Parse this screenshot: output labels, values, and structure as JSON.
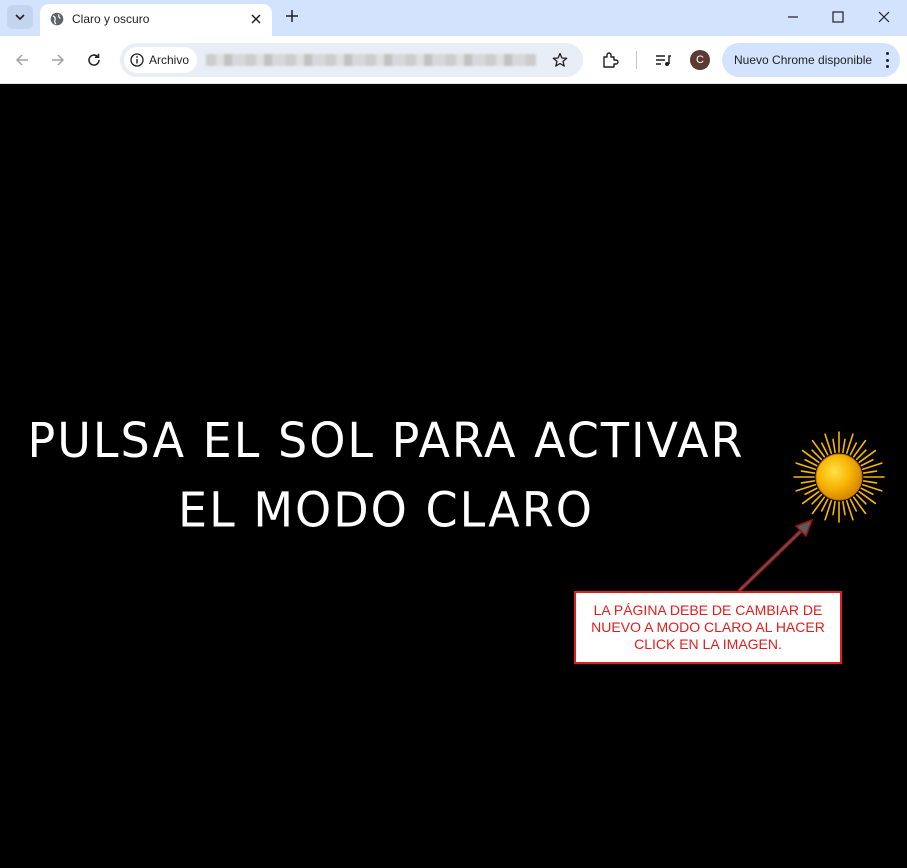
{
  "browser": {
    "tab_title": "Claro y oscuro",
    "site_chip_label": "Archivo",
    "update_button_label": "Nuevo Chrome disponible",
    "profile_initial": "C",
    "icons": [
      "tab-search-icon",
      "globe-icon",
      "close-icon",
      "plus-icon",
      "minimize-icon",
      "maximize-icon",
      "window-close-icon",
      "back-icon",
      "forward-icon",
      "reload-icon",
      "info-icon",
      "star-icon",
      "extensions-icon",
      "media-icon",
      "menu-dots-icon"
    ]
  },
  "page": {
    "headline_line1": "Pulsa el sol para activar",
    "headline_line2": "el modo claro",
    "sun_icon": "sun-icon",
    "callout_text": "LA PÁGINA DEBE DE CAMBIAR DE NUEVO A MODO CLARO AL HACER CLICK EN LA IMAGEN.",
    "colors": {
      "background": "#000000",
      "headline": "#ffffff",
      "callout_text": "#e11d1d",
      "callout_border": "#e11d1d",
      "sun": "#f6b400"
    }
  }
}
